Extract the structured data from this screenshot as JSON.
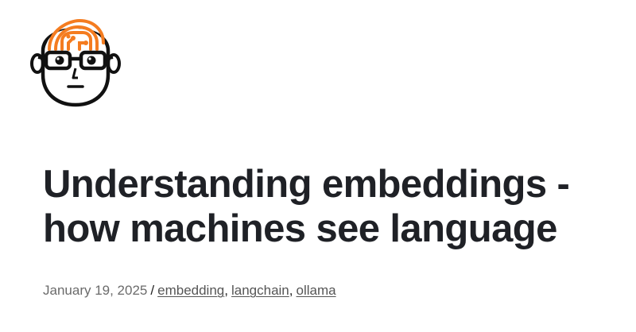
{
  "header": {
    "logo_icon": "nerd-face-circuit-brain-logo",
    "accent_color": "#f47c20"
  },
  "post": {
    "title": "Understanding embeddings - how machines see language",
    "date": "January 19, 2025",
    "separator": "/",
    "tags": [
      "embedding",
      "langchain",
      "ollama"
    ],
    "tag_separator": ","
  },
  "colors": {
    "title": "#1f2126",
    "meta": "#6b6b6b",
    "link": "#555555"
  }
}
